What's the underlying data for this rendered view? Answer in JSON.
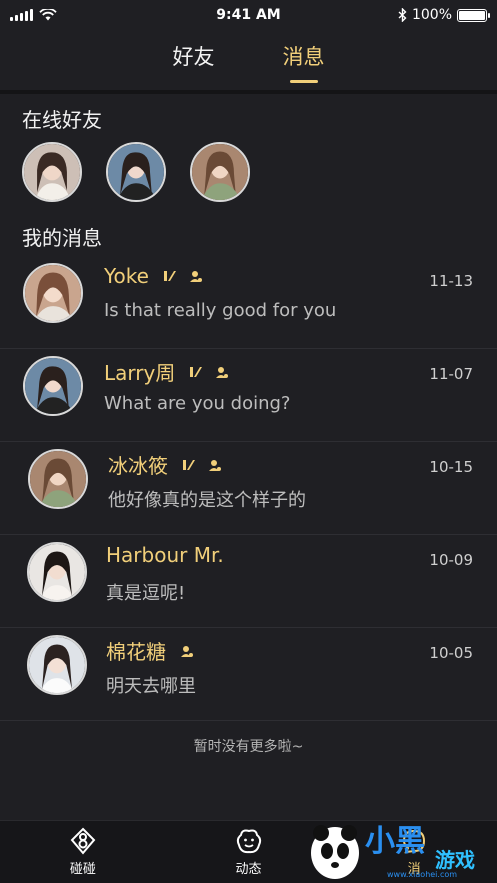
{
  "status_bar": {
    "time": "9:41 AM",
    "battery": "100%"
  },
  "tabs": [
    {
      "label": "好友",
      "active": false
    },
    {
      "label": "消息",
      "active": true
    }
  ],
  "online_friends": {
    "title": "在线好友"
  },
  "messages_section": {
    "title": "我的消息"
  },
  "messages": [
    {
      "name": "Yoke",
      "text": "Is that really good for you",
      "date": "11-13"
    },
    {
      "name": "Larry周",
      "text": "What are you doing?",
      "date": "11-07"
    },
    {
      "name": "冰冰筱",
      "text": "他好像真的是这个样子的",
      "date": "10-15"
    },
    {
      "name": "Harbour  Mr.",
      "text": "真是逗呢!",
      "date": "10-09"
    },
    {
      "name": "棉花糖",
      "text": "明天去哪里",
      "date": "10-05"
    }
  ],
  "footer_note": "暂时没有更多啦~",
  "bottom_nav": [
    {
      "label": "碰碰",
      "icon": "logo-icon"
    },
    {
      "label": "动态",
      "icon": "smiley-icon"
    },
    {
      "label": "消",
      "icon": "chat-icon"
    }
  ],
  "watermark": {
    "text": "小黑游戏",
    "url_text": "www.xiaohei.com"
  },
  "colors": {
    "accent": "#f1cf7a",
    "background": "#1f1f23"
  }
}
